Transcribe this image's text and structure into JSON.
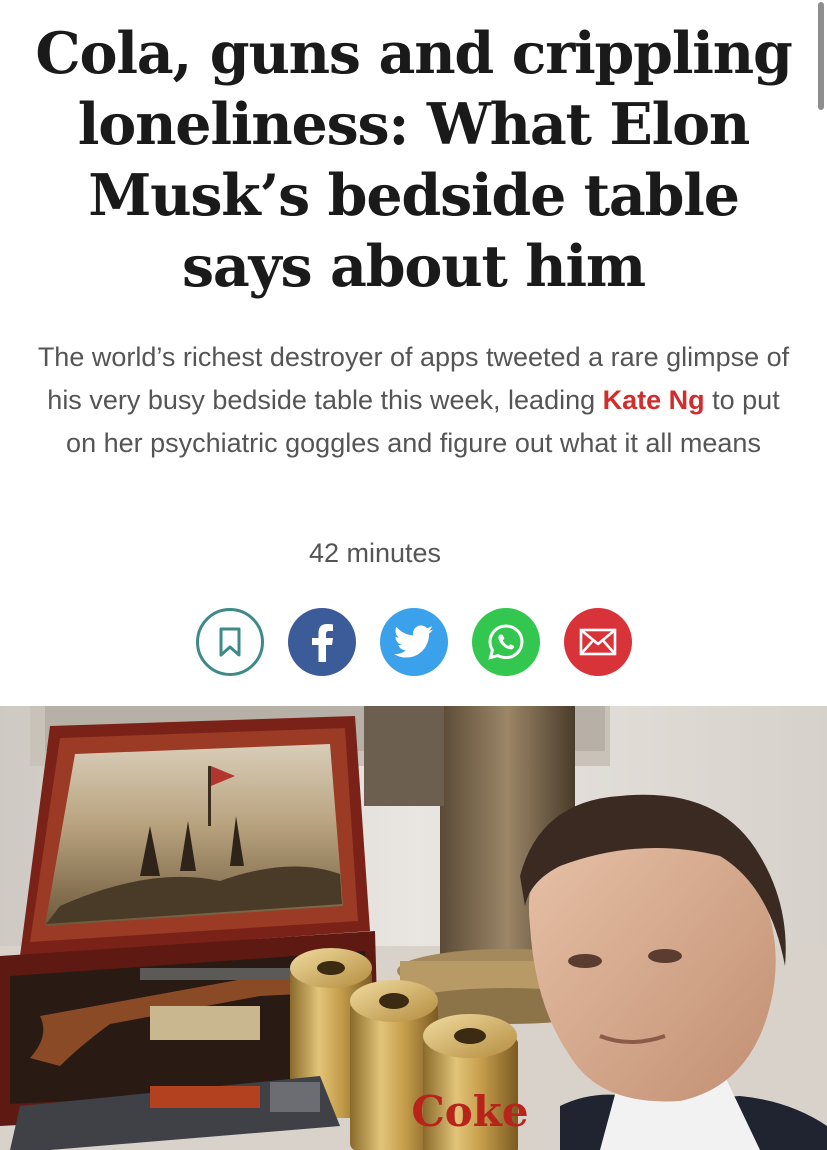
{
  "article": {
    "headline": "Cola, guns and crippling loneliness: What Elon Musk’s bedside table says about him",
    "standfirst_before": "The world’s richest destroyer of apps tweeted a rare glimpse of his very busy bedside table this week, leading ",
    "author": "Kate Ng",
    "standfirst_after": " to put on her psychiatric goggles and figure out what it all means",
    "timestamp": "42 minutes"
  },
  "share": {
    "buttons": [
      {
        "icon": "bookmark-icon",
        "color": "#3d8a88"
      },
      {
        "icon": "facebook-icon",
        "color": "#3b5b99"
      },
      {
        "icon": "twitter-icon",
        "color": "#3aa1ea"
      },
      {
        "icon": "whatsapp-icon",
        "color": "#33c74f"
      },
      {
        "icon": "email-icon",
        "color": "#d9333a"
      }
    ]
  },
  "hero_image": {
    "can_text": "Coke"
  },
  "colors": {
    "headline": "#1a1a1a",
    "body_text": "#555555",
    "author_link": "#d12d2d"
  }
}
